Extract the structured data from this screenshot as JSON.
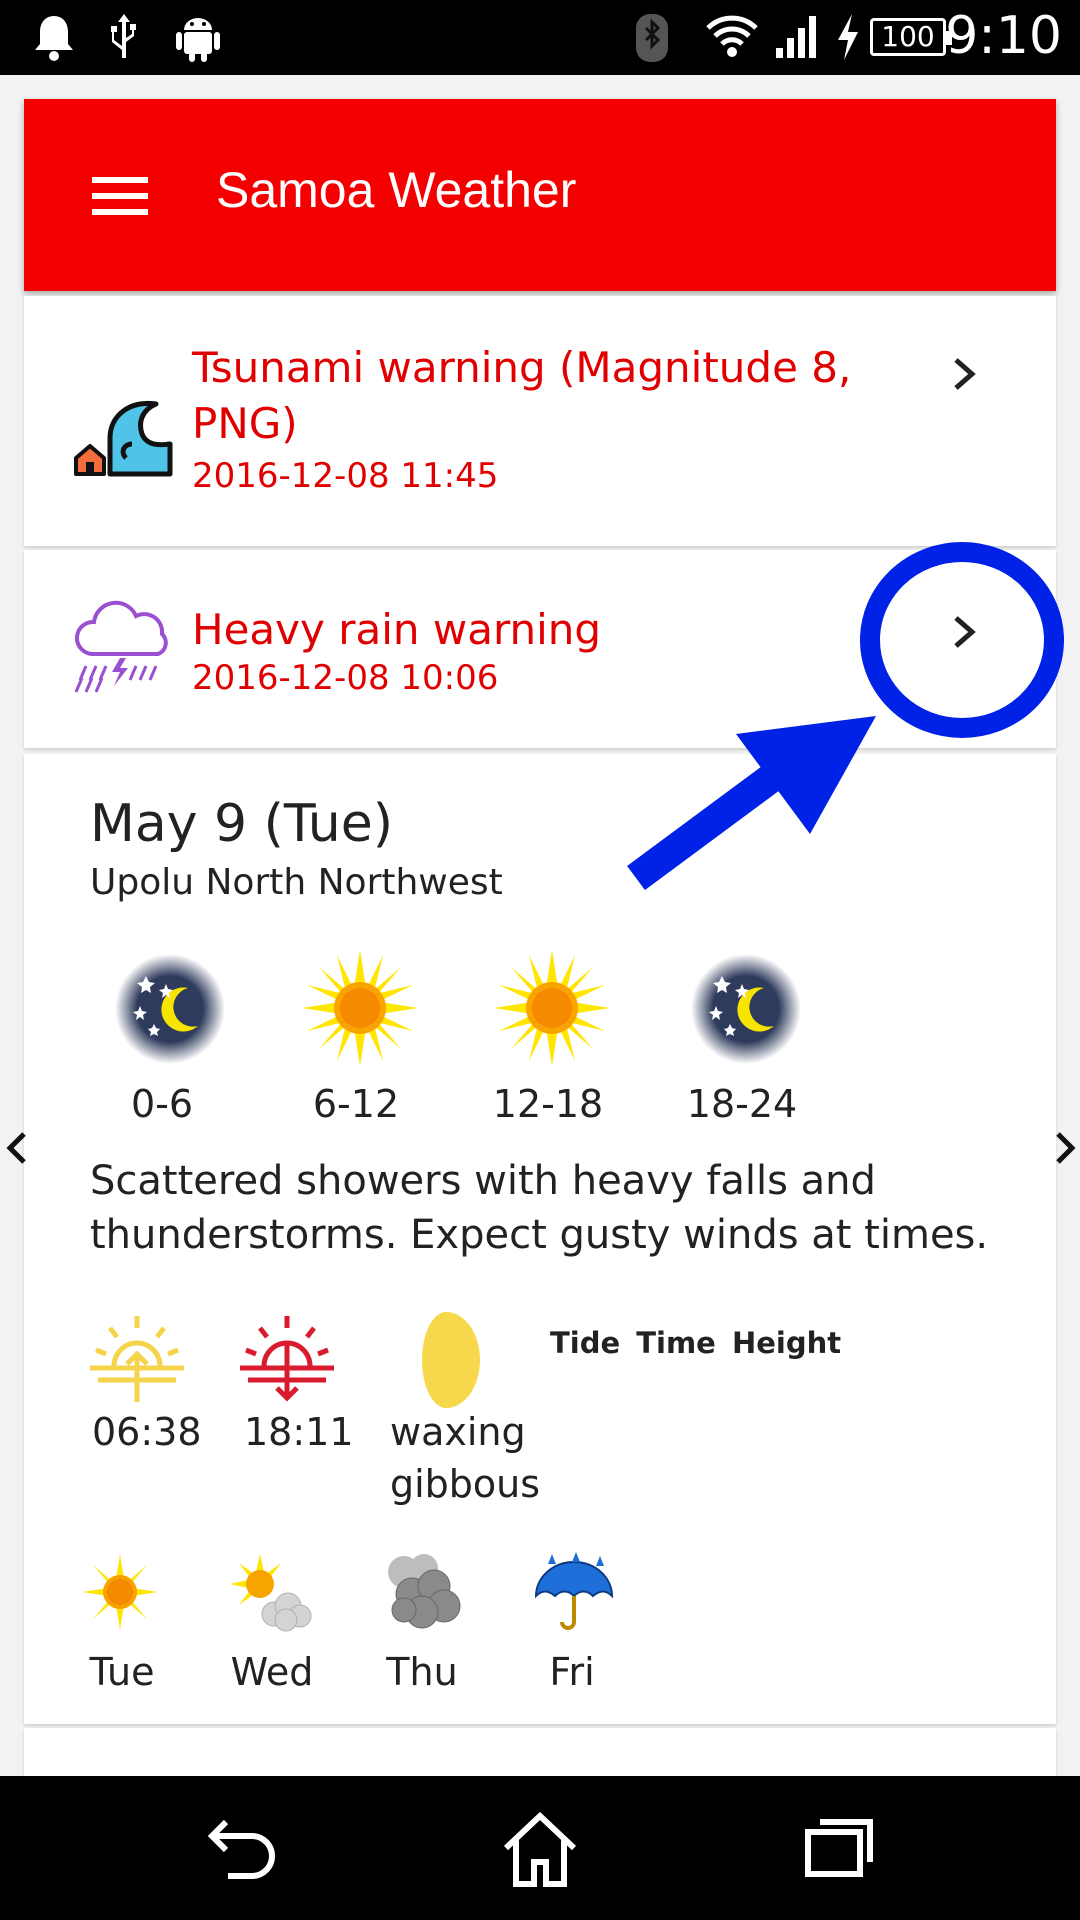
{
  "status_bar": {
    "battery": "100",
    "time": "9:10",
    "icons": [
      "bell-icon",
      "usb-icon",
      "android-icon",
      "bluetooth-icon",
      "wifi-icon",
      "signal-icon",
      "charging-icon"
    ]
  },
  "app_bar": {
    "title": "Samoa Weather",
    "color": "#f50000"
  },
  "warnings": [
    {
      "title_line1": "Tsunami warning (Magnitude 8,",
      "title_line2": "PNG)",
      "time": "2016-12-08 11:45",
      "icon": "tsunami-icon"
    },
    {
      "title": "Heavy rain warning",
      "time": "2016-12-08 10:06",
      "icon": "heavy-rain-icon"
    }
  ],
  "forecast": {
    "date": "May 9 (Tue)",
    "region": "Upolu North Northwest",
    "periods": [
      {
        "label": "0-6",
        "icon": "clear-night-icon"
      },
      {
        "label": "6-12",
        "icon": "sunny-icon"
      },
      {
        "label": "12-18",
        "icon": "sunny-icon"
      },
      {
        "label": "18-24",
        "icon": "clear-night-icon"
      }
    ],
    "text_line1": "Scattered showers with heavy falls and",
    "text_line2": "thunderstorms. Expect gusty winds at times.",
    "sunrise": "06:38",
    "sunset": "18:11",
    "moon_line1": "waxing",
    "moon_line2": "gibbous",
    "tide_header": "Tide Time Height",
    "days": [
      {
        "label": "Tue",
        "icon": "sunny-icon"
      },
      {
        "label": "Wed",
        "icon": "partly-cloudy-icon"
      },
      {
        "label": "Thu",
        "icon": "cloudy-icon"
      },
      {
        "label": "Fri",
        "icon": "rain-umbrella-icon"
      }
    ]
  },
  "annotation": {
    "color": "#0022e6"
  }
}
